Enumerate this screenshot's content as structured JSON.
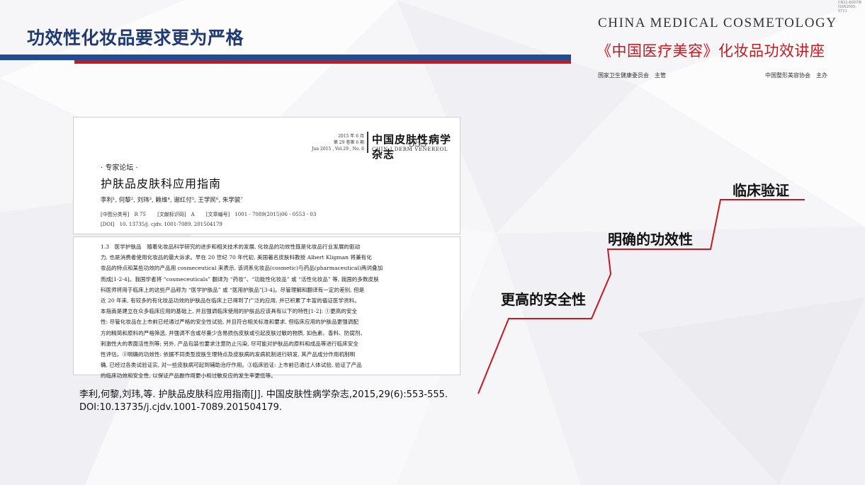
{
  "slide": {
    "title": "功效性化妆品要求更为严格"
  },
  "brand": {
    "english": "CHINA MEDICAL COSMETOLOGY",
    "chinese": "《中国医疗美容》化妆品功效讲座",
    "code_line1": "CN11-6007/R",
    "code_line2": "ISSN2095-0721",
    "sponsor_left": "国家卫生健康委员会　主管",
    "sponsor_right": "中国整形美容协会　主办"
  },
  "article": {
    "date_cn": "2015 年 6 月",
    "volume_cn": "第 29 卷第 6 期",
    "date_en": "Jun 2015 , Vol.29 , No. 6",
    "journal_cn": "中国皮肤性病学杂志",
    "journal_en": "CHIN J DERM VENEREOL",
    "page": "553",
    "section": "· 专家论坛 ·",
    "title": "护肤品皮肤科应用指南",
    "authors": "李利¹, 何黎², 刘玮³, 赖维⁴, 谢红付⁵, 王学民⁶, 朱学骏⁷",
    "class_no": "[中图分类号]　R 75",
    "doc_code": "[文献标识码]　A",
    "article_no": "[文章编号]　1001 - 7089(2015)06 - 0553 - 03",
    "doi": "[DOI]　10. 13735/j. cjdv. 1001-7089. 201504179",
    "body_lines": [
      "1.3　医学护肤品　随着化妆品科学研究的进步和相关技术的发展, 化妆品的功效性既是化妆品行业发展的驱动",
      "力, 也是消费者使用化妆品的最大诉求。早在 20 世纪 70 年代初, 美国著名皮肤科教授 Albert Kligman 将兼有化",
      "妆品的特点和某些功效的产品用 cosmeceutical 来表示, 该词系化妆品(cosmetic)与药品(pharmaceutical)两词叠加",
      "而成[1-2-4]。我国学者将 “cosmeceuticals” 翻译为 “药妆”、“功能性化妆品” 或 “活性化妆品” 等, 我国的多数皮肤",
      "科医师将用于临床上的这些产品称为 “医学护肤品” 或 “医用护肤品”[3-4]。尽管理解和翻译有一定的差别, 但是",
      "近 20 年来, 有较多的有化妆品功效的护肤品在临床上已得到了广泛的应用, 并已积累了丰富的循证医学资料。",
      "本指南是建立在众多临床应用的基础上, 并且强调临床使用的护肤品应该具有以下的特性[1-2]: ①更高的安全",
      "性: 尽管化妆品在上市前已经通过严格的安全性试验, 并且符合相关标准和要求, 但临床应用的护肤品更强调配",
      "方的精简和原料的严格筛选, 并强调不含或尽量少含易损伤皮肤或引起皮肤过敏的物质, 如色素、香料、防腐剂、",
      "刺激性大的表面活性剂等; 另外, 产品包装也要求注意防止污染, 尽可能对护肤品的原料和成品等进行临床安全",
      "性评估。②明确的功效性: 依据不同类型皮肤生理特点及皮肤病的发病机制进行研发, 其产品成分作用机制明",
      "确, 已经过各类试验证实, 对一些皮肤病可起到辅助治疗作用。③临床验证: 上市前已通过人体试验, 验证了产品",
      "的临床功效和安全性, 以保证产品副作用更小和过敏反应的发生率更低等。"
    ]
  },
  "citation": "李利,何黎,刘玮,等. 护肤品皮肤科应用指南[J]. 中国皮肤性病学杂志,2015,29(6):553-555. DOI:10.13735/j.cjdv.1001-7089.201504179.",
  "steps": [
    {
      "label": "更高的安全性"
    },
    {
      "label": "明确的功效性"
    },
    {
      "label": "临床验证"
    }
  ],
  "colors": {
    "title": "#1f3a73",
    "bar_blue": "#1f4e97",
    "accent_red": "#c8171d"
  }
}
